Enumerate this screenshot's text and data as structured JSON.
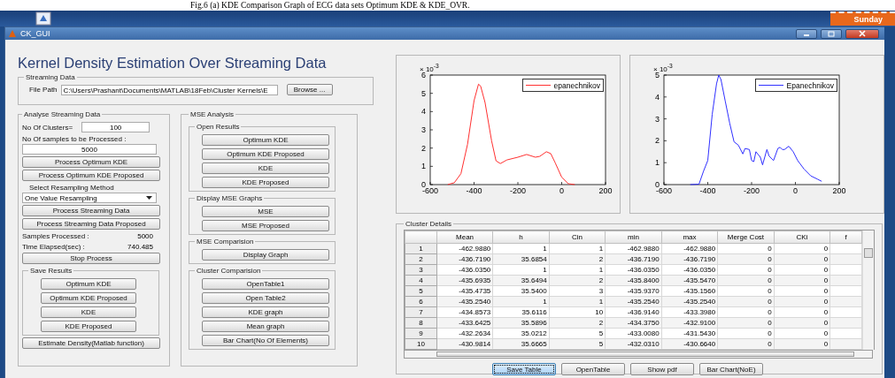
{
  "caption": "Fig.6 (a) KDE Comparison Graph of ECG data sets Optimum KDE & KDE_OVR.",
  "clock": {
    "day": "Sunday"
  },
  "window": {
    "title": "CK_GUI"
  },
  "heading": "Kernel Density Estimation Over Streaming Data",
  "streaming_data": {
    "label": "Streaming Data",
    "file_path_label": "File Path",
    "file_path": "C:\\Users\\Prashant\\Documents\\MATLAB\\18Feb\\Cluster Kernels\\E",
    "browse": "Browse ..."
  },
  "analyse": {
    "label": "Analyse Streaming Data",
    "clusters_label": "No Of Clusters=",
    "clusters": "100",
    "samples_label": "No Of samples to be Processed :",
    "samples": "5000",
    "process_buttons": [
      "Process Optimum KDE",
      "Process Optimum KDE Proposed"
    ],
    "resampling_label": "Select Resampling Method",
    "resampling": "One Value Resampling",
    "stream_buttons": [
      "Process Streaming Data",
      "Process Streaming Data Proposed"
    ],
    "processed_label": "Samples Processed :",
    "processed": "5000",
    "elapsed_label": "Time Elapsed(sec) :",
    "elapsed": "740.485",
    "stop": "Stop Process",
    "save": {
      "label": "Save Results",
      "buttons": [
        "Optimum KDE",
        "Optimum KDE Proposed",
        "KDE",
        "KDE Proposed"
      ]
    },
    "estimate": "Estimate Density(Matlab function)"
  },
  "mse": {
    "label": "MSE Analysis",
    "groups": [
      {
        "label": "Open Results",
        "buttons": [
          "Optimum KDE",
          "Optimum KDE Proposed",
          "KDE",
          "KDE Proposed"
        ]
      },
      {
        "label": "Display MSE Graphs",
        "buttons": [
          "MSE",
          "MSE Proposed"
        ]
      },
      {
        "label": "MSE Comparision",
        "buttons": [
          "Display Graph"
        ]
      },
      {
        "label": "Cluster Comparision",
        "buttons": [
          "OpenTable1",
          "Open Table2",
          "KDE graph",
          "Mean graph",
          "Bar Chart(No Of Elements)"
        ]
      }
    ]
  },
  "charts": [
    {
      "multiplier": "× 10$^{-3}$",
      "chart_data": {
        "type": "line",
        "xlim": [
          -600,
          200
        ],
        "ylim": [
          0,
          6
        ],
        "xticks": [
          -600,
          -400,
          -200,
          0,
          200
        ],
        "yticks": [
          0,
          1,
          2,
          3,
          4,
          5,
          6
        ],
        "x": [
          -520,
          -490,
          -460,
          -430,
          -400,
          -380,
          -370,
          -350,
          -320,
          -300,
          -280,
          -250,
          -200,
          -160,
          -120,
          -100,
          -70,
          -50,
          -30,
          0,
          30,
          60
        ],
        "series": [
          {
            "name": "epanechnikov",
            "color": "#ff3030",
            "values": [
              0,
              0.1,
              0.6,
              2.2,
              4.6,
              5.5,
              5.4,
              4.5,
              2.4,
              1.3,
              1.15,
              1.35,
              1.5,
              1.65,
              1.5,
              1.55,
              1.8,
              1.7,
              1.2,
              0.4,
              0.05,
              0
            ]
          }
        ]
      }
    },
    {
      "multiplier": "× 10$^{-3}$",
      "chart_data": {
        "type": "line",
        "xlim": [
          -600,
          200
        ],
        "ylim": [
          0,
          5
        ],
        "xticks": [
          -600,
          -400,
          -200,
          0,
          200
        ],
        "yticks": [
          0,
          1,
          2,
          3,
          4,
          5
        ],
        "x": [
          -480,
          -440,
          -420,
          -400,
          -380,
          -360,
          -350,
          -340,
          -320,
          -300,
          -280,
          -260,
          -240,
          -230,
          -210,
          -200,
          -190,
          -180,
          -160,
          -150,
          -130,
          -120,
          -100,
          -80,
          -70,
          -60,
          -50,
          -30,
          -10,
          10,
          40,
          70,
          100,
          120
        ],
        "series": [
          {
            "name": "Epanechnikov",
            "color": "#3030ff",
            "values": [
              0,
              0.02,
              0.6,
              1.1,
              3.2,
              4.6,
              5.0,
              4.8,
              3.8,
              2.8,
              1.95,
              1.8,
              1.4,
              1.65,
              1.6,
              1.1,
              1.05,
              1.5,
              1.25,
              0.9,
              1.6,
              1.3,
              1.1,
              1.65,
              1.7,
              1.6,
              1.6,
              1.75,
              1.5,
              1.1,
              0.7,
              0.4,
              0.25,
              0.15
            ]
          }
        ]
      }
    }
  ],
  "cluster_details": {
    "label": "Cluster Details",
    "columns": [
      "Mean",
      "h",
      "Cin",
      "min",
      "max",
      "Merge Cost",
      "CKi",
      "f"
    ],
    "rows": [
      {
        "header": "1",
        "cells": [
          "-462.9880",
          "1",
          "1",
          "-462.9880",
          "-462.9880",
          "0",
          "0"
        ]
      },
      {
        "header": "2",
        "cells": [
          "-436.7190",
          "35.6854",
          "2",
          "-436.7190",
          "-436.7190",
          "0",
          "0"
        ]
      },
      {
        "header": "3",
        "cells": [
          "-436.0350",
          "1",
          "1",
          "-436.0350",
          "-436.0350",
          "0",
          "0"
        ]
      },
      {
        "header": "4",
        "cells": [
          "-435.6935",
          "35.6494",
          "2",
          "-435.8400",
          "-435.5470",
          "0",
          "0"
        ]
      },
      {
        "header": "5",
        "cells": [
          "-435.4735",
          "35.5400",
          "3",
          "-435.9370",
          "-435.1560",
          "0",
          "0"
        ]
      },
      {
        "header": "6",
        "cells": [
          "-435.2540",
          "1",
          "1",
          "-435.2540",
          "-435.2540",
          "0",
          "0"
        ]
      },
      {
        "header": "7",
        "cells": [
          "-434.8573",
          "35.6116",
          "10",
          "-436.9140",
          "-433.3980",
          "0",
          "0"
        ]
      },
      {
        "header": "8",
        "cells": [
          "-433.6425",
          "35.5896",
          "2",
          "-434.3750",
          "-432.9100",
          "0",
          "0"
        ]
      },
      {
        "header": "9",
        "cells": [
          "-432.2634",
          "35.0212",
          "5",
          "-433.0080",
          "-431.5430",
          "0",
          "0"
        ]
      },
      {
        "header": "10",
        "cells": [
          "-430.9814",
          "35.6665",
          "5",
          "-432.0310",
          "-430.6640",
          "0",
          "0"
        ]
      }
    ],
    "buttons": [
      {
        "label": "Save Table",
        "selected": true
      },
      {
        "label": "OpenTable",
        "selected": false
      },
      {
        "label": "Show pdf",
        "selected": false
      },
      {
        "label": "Bar Chart(NoE)",
        "selected": false
      }
    ]
  }
}
